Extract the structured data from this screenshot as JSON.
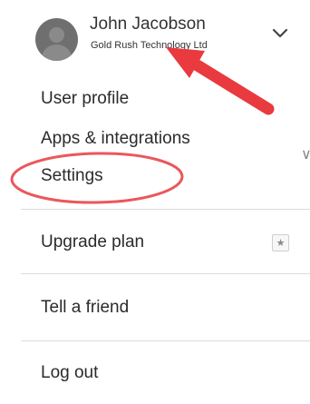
{
  "user": {
    "name": "John Jacobson",
    "organization": "Gold Rush Technology Ltd"
  },
  "menu": {
    "items": [
      {
        "label": "User profile"
      },
      {
        "label": "Apps & integrations"
      },
      {
        "label": "Settings"
      },
      {
        "label": "Upgrade plan"
      },
      {
        "label": "Tell a friend"
      },
      {
        "label": "Log out"
      }
    ]
  },
  "icons": {
    "avatar": "avatar-icon",
    "dropdown": "chevron-down-icon",
    "upgrade_badge": "star-icon",
    "arrow_annotation": "arrow-icon",
    "settings_highlight": "ellipse-highlight"
  },
  "colors": {
    "annotation_red": "#e83a3f",
    "divider": "#dcdcdc",
    "text": "#2b2b2b",
    "avatar": "#6f6f6f"
  }
}
